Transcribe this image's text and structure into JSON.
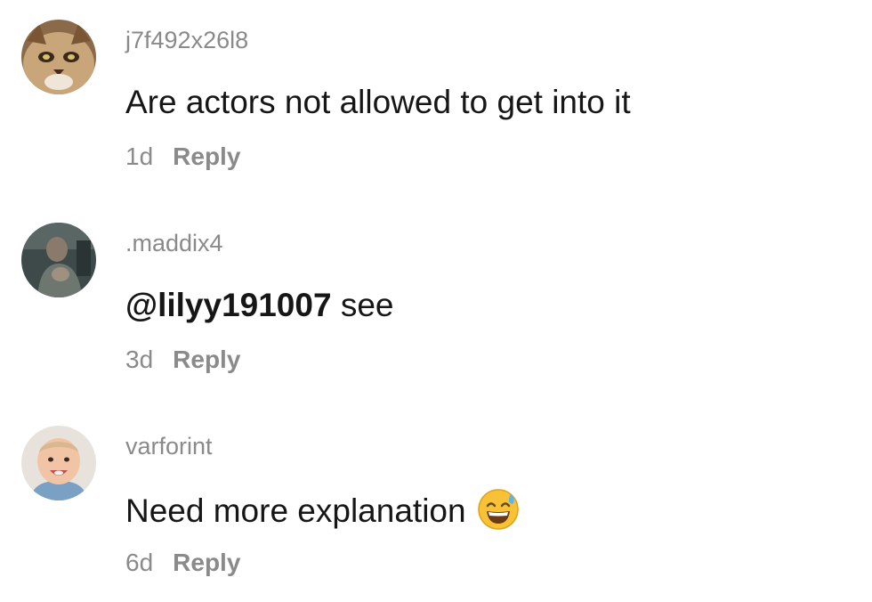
{
  "comments": [
    {
      "username": "j7f492x26l8",
      "text": "Are actors not allowed to get into it",
      "time": "1d",
      "reply_label": "Reply",
      "avatar": "cat-avatar"
    },
    {
      "username": ".maddix4",
      "mention": "@lilyy191007",
      "text": " see",
      "time": "3d",
      "reply_label": "Reply",
      "avatar": "person-avatar"
    },
    {
      "username": "varforint",
      "text": "Need more explanation",
      "emoji": "grinning-face-with-sweat-icon",
      "time": "6d",
      "reply_label": "Reply",
      "avatar": "baby-avatar"
    }
  ],
  "colors": {
    "primary_text": "#161616",
    "secondary_text": "#8a8a8a",
    "background": "#ffffff"
  }
}
